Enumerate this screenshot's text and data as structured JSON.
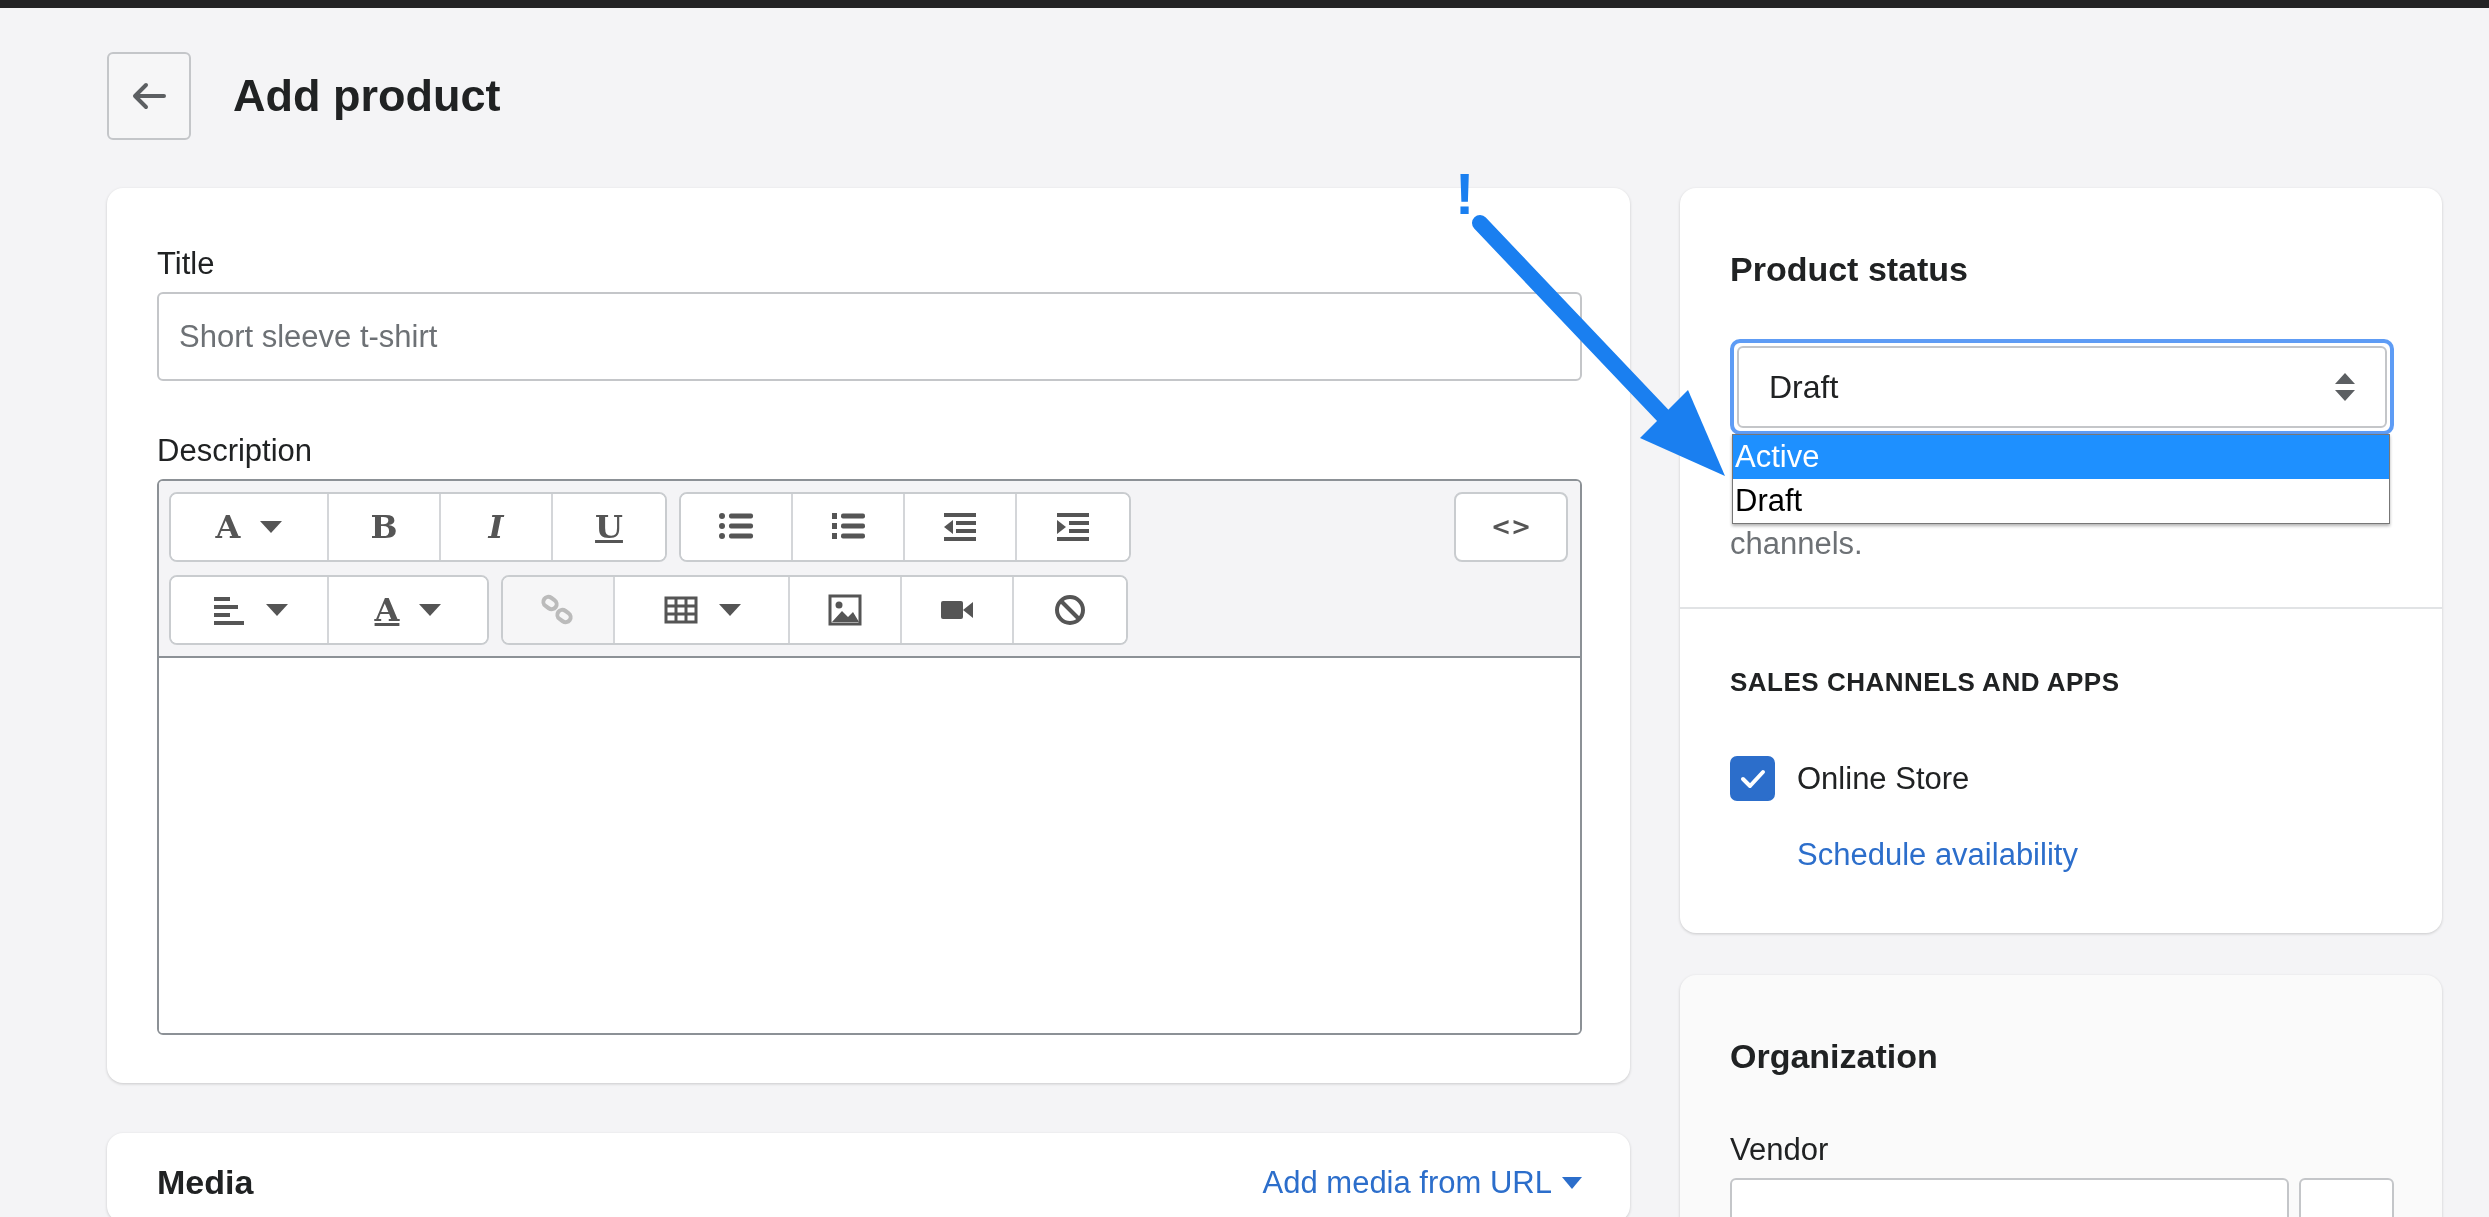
{
  "header": {
    "title": "Add product"
  },
  "product_card": {
    "title_label": "Title",
    "title_placeholder": "Short sleeve t-shirt",
    "description_label": "Description",
    "toolbar": [
      {
        "groups": [
          [
            {
              "kind": "font",
              "label": "A",
              "caret": true,
              "disabled": false
            },
            {
              "kind": "bold",
              "label": "B",
              "caret": false,
              "disabled": false
            },
            {
              "kind": "italic",
              "label": "I",
              "caret": false,
              "disabled": false
            },
            {
              "kind": "underline",
              "label": "U",
              "caret": false,
              "disabled": false
            }
          ],
          [
            {
              "kind": "bullets",
              "caret": false,
              "disabled": false
            },
            {
              "kind": "numbers",
              "caret": false,
              "disabled": false
            },
            {
              "kind": "outdent",
              "caret": false,
              "disabled": false
            },
            {
              "kind": "indent",
              "caret": false,
              "disabled": false
            }
          ]
        ],
        "end": {
          "label": "<>"
        }
      },
      {
        "groups": [
          [
            {
              "kind": "align",
              "caret": true,
              "disabled": false
            },
            {
              "kind": "color",
              "label": "A",
              "caret": true,
              "disabled": false
            }
          ],
          [
            {
              "kind": "link",
              "caret": false,
              "disabled": true
            },
            {
              "kind": "table",
              "caret": true,
              "disabled": false
            },
            {
              "kind": "image",
              "caret": false,
              "disabled": false
            },
            {
              "kind": "video",
              "caret": false,
              "disabled": false
            },
            {
              "kind": "clear",
              "caret": false,
              "disabled": false
            }
          ]
        ]
      }
    ]
  },
  "media_card": {
    "title": "Media",
    "link": "Add media from URL"
  },
  "status_card": {
    "title": "Product status",
    "value": "Draft",
    "options": [
      {
        "label": "Active",
        "highlighted": true
      },
      {
        "label": "Draft",
        "highlighted": false
      }
    ],
    "help_text": "channels.",
    "section_title": "SALES CHANNELS AND APPS",
    "channels": [
      {
        "label": "Online Store",
        "checked": true
      }
    ],
    "schedule_link": "Schedule availability"
  },
  "organization_card": {
    "title": "Organization",
    "vendor_label": "Vendor"
  },
  "annotation": {
    "mark": "!"
  }
}
